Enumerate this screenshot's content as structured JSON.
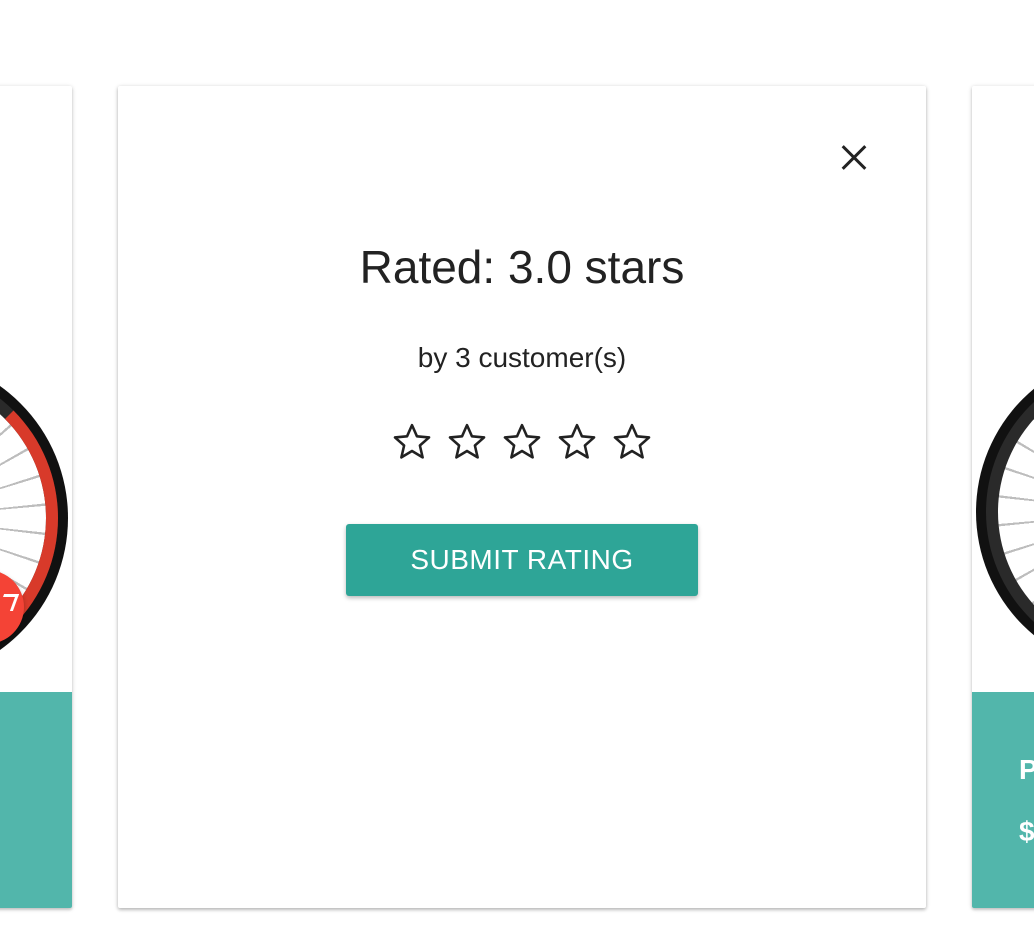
{
  "rating": {
    "title": "Rated: 3.0 stars",
    "subtitle": "by 3 customer(s)",
    "stars_total": 5,
    "stars_filled": 0,
    "submit_label": "SUBMIT RATING"
  },
  "right_card": {
    "footer_line1": "P",
    "footer_line2": "$"
  },
  "colors": {
    "accent": "#2ea597",
    "card_footer": "#52b6ab",
    "badge": "#f44336",
    "text": "#222222"
  },
  "icons": {
    "close": "close-icon",
    "star": "star-outline-icon"
  }
}
